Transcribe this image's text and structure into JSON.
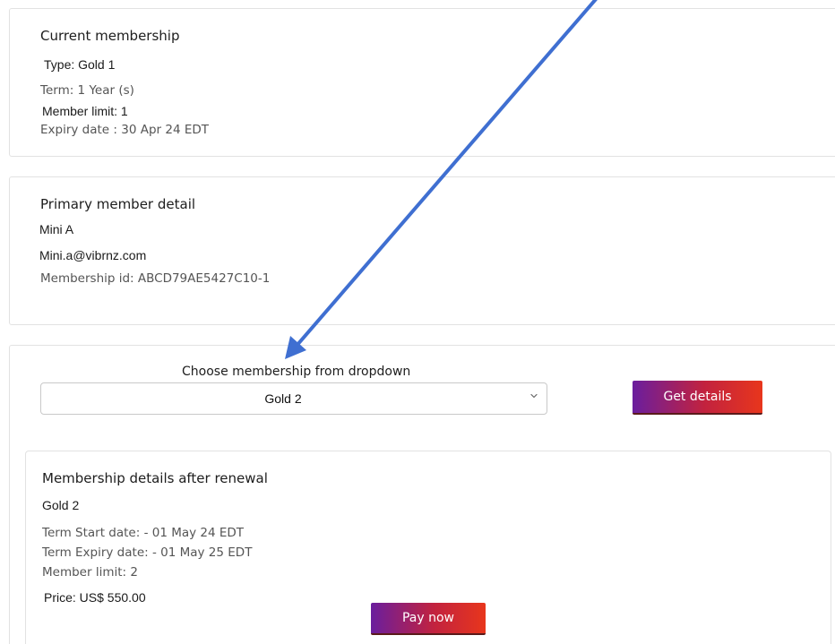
{
  "current_membership": {
    "heading": "Current membership",
    "type": "Type: Gold 1",
    "term": "Term: 1 Year (s)",
    "member_limit": "Member limit: 1",
    "expiry": "Expiry date : 30 Apr 24 EDT"
  },
  "primary_member": {
    "heading": "Primary member detail",
    "name": "Mini A",
    "email": "Mini.a@vibrnz.com",
    "membership_id": "Membership id: ABCD79AE5427C10-1"
  },
  "choose": {
    "label": "Choose membership from dropdown",
    "selected": "Gold 2",
    "get_details_label": "Get details"
  },
  "renewal": {
    "heading": "Membership details after renewal",
    "plan": "Gold 2",
    "term_start": "Term Start date: - 01 May 24 EDT",
    "term_expiry": "Term Expiry date: - 01 May 25 EDT",
    "member_limit": "Member limit: 2",
    "price": "Price: US$ 550.00",
    "pay_now_label": "Pay now"
  },
  "colors": {
    "annotation_arrow": "#3f6fd1",
    "button_gradient_start": "#6a1e9e",
    "button_gradient_end": "#e8361c"
  },
  "icons": {
    "dropdown": "chevron-down-icon",
    "annotation": "annotation-arrow"
  }
}
